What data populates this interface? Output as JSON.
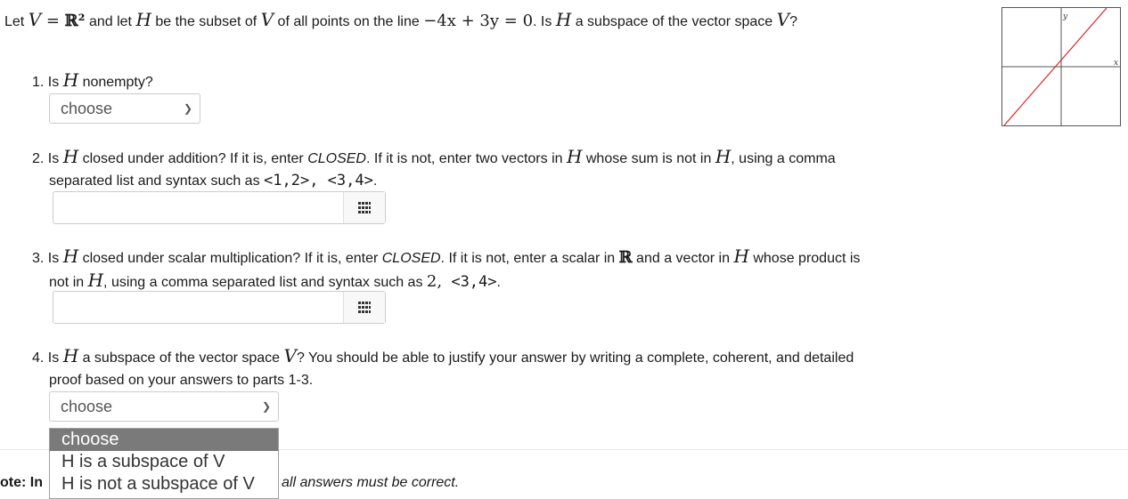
{
  "header": {
    "prefix": "Let ",
    "V": "V",
    "eq": " = ",
    "R2": "ℝ²",
    "and_let": " and let ",
    "H": "H",
    "be_subset": " be the subset of ",
    "of_points": " of all points on the line ",
    "equation": "−4x + 3y = 0",
    "is": ". Is ",
    "a_subspace": " a subspace of the vector space ",
    "qmark": "?"
  },
  "questions": [
    {
      "num": "1. Is ",
      "text": " nonempty?",
      "select_value": "choose"
    },
    {
      "num": "2. Is ",
      "text1": " closed under addition? If it is, enter ",
      "closed": "CLOSED",
      "text2": ". If it is not, enter two vectors in ",
      "text3": " whose sum is not in ",
      "text4": ", using a comma",
      "text5": "separated list and syntax such as ",
      "example": "<1,2>, <3,4>",
      "end": "."
    },
    {
      "num": "3. Is ",
      "text1": " closed under scalar multiplication? If it is, enter ",
      "closed": "CLOSED",
      "text2": ". If it is not, enter a scalar in ",
      "R": "ℝ",
      "text3": " and a vector in ",
      "text4": " whose product is",
      "text5": "not in ",
      "text6": ", using a comma separated list and syntax such as ",
      "example_num": "2,",
      "example": " <3,4>",
      "end": "."
    },
    {
      "num": "4. Is ",
      "text1": " a subspace of the vector space ",
      "text2": "? You should be able to justify your answer by writing a complete, coherent, and detailed",
      "text3": "proof based on your answers to parts 1-3.",
      "select_value": "choose"
    }
  ],
  "dropdown_options": [
    "choose",
    "H is a subspace of V",
    "H is not a subspace of V"
  ],
  "note": {
    "left": "ote: In",
    "right": "all answers must be correct."
  },
  "graph": {
    "y_label": "y",
    "x_label": "x",
    "line_color": "#e02020"
  }
}
